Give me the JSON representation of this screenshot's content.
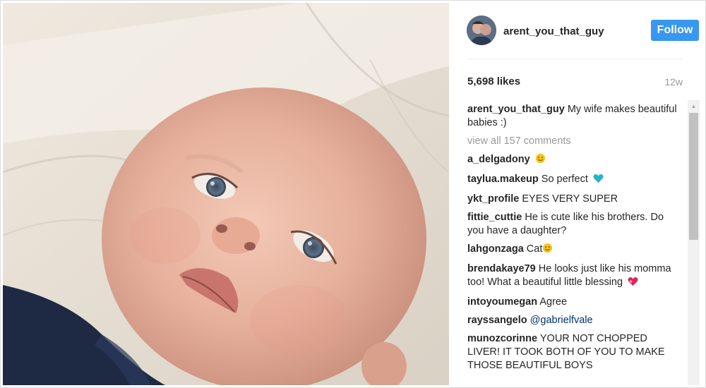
{
  "post": {
    "username": "arent_you_that_guy",
    "follow_label": "Follow",
    "likes": "5,698 likes",
    "age": "12w",
    "caption_user": "arent_you_that_guy",
    "caption_text": "My wife makes beautiful babies :)",
    "view_all": "view all 157 comments"
  },
  "comments": [
    {
      "user": "a_delgadony",
      "text": "",
      "emoji": "smile-emoji"
    },
    {
      "user": "taylua.makeup",
      "text": "So perfect",
      "emoji": "heart-emoji"
    },
    {
      "user": "ykt_profile",
      "text": "EYES VERY SUPER",
      "emoji": ""
    },
    {
      "user": "fittie_cuttie",
      "text": "He is cute like his brothers. Do you have a daughter?",
      "emoji": ""
    },
    {
      "user": "lahgonzaga",
      "text": "Cat",
      "emoji": "smile-emoji"
    },
    {
      "user": "brendakaye79",
      "text": "He looks just like his momma too! What a beautiful little blessing",
      "emoji": "sparkling-heart-emoji"
    },
    {
      "user": "intoyoumegan",
      "text": "Agree",
      "emoji": ""
    },
    {
      "user": "rayssangelo",
      "text": "",
      "mention": "@gabrielfvale",
      "emoji": ""
    },
    {
      "user": "munozcorinne",
      "text": "YOUR NOT CHOPPED LIVER! IT TOOK BOTH OF YOU TO MAKE THOSE BEAUTIFUL BOYS",
      "emoji": ""
    }
  ],
  "colors": {
    "follow_button": "#3897f0",
    "muted_text": "#999999",
    "mention": "#003569",
    "heart": "#26b3c4",
    "smile": "#f5c518"
  }
}
